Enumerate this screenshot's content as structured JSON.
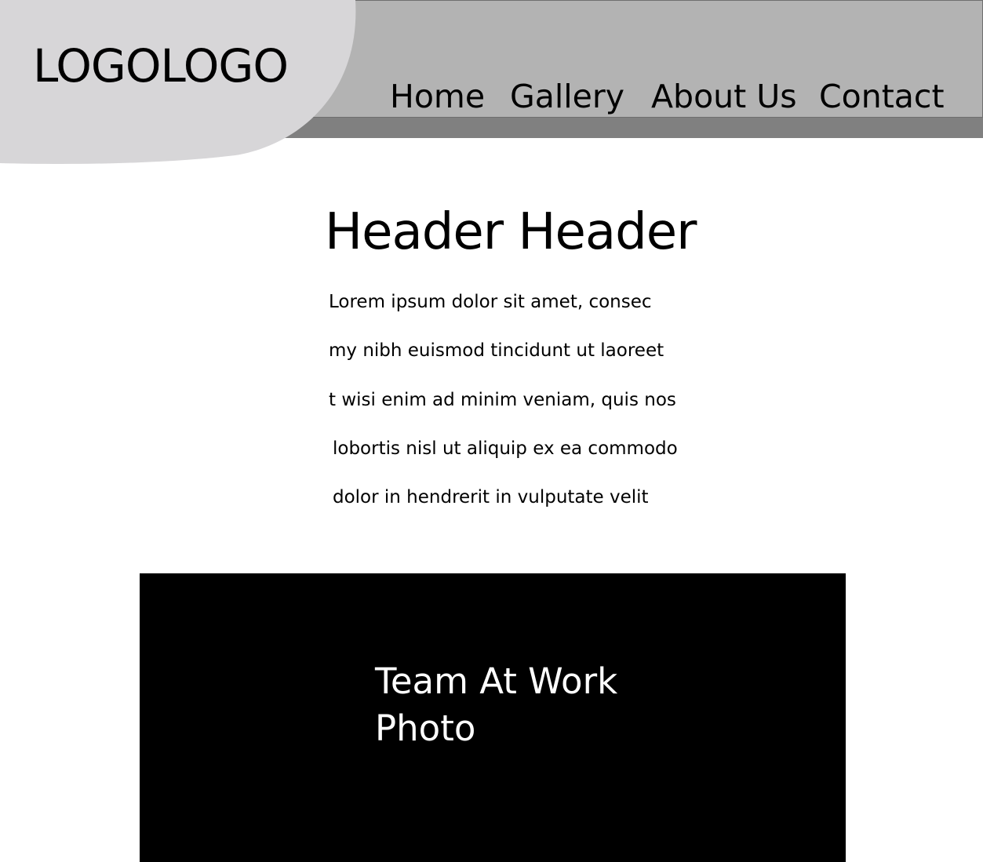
{
  "header": {
    "logo_text": "LOGOLOGO",
    "nav": [
      {
        "label": "Home"
      },
      {
        "label": "Gallery"
      },
      {
        "label": "About Us"
      },
      {
        "label": "Contact"
      }
    ]
  },
  "main": {
    "title": "Header Header",
    "paragraph_lines": [
      "Lorem ipsum dolor sit amet, consec",
      "my nibh euismod tincidunt ut laoreet",
      "t wisi enim ad minim veniam, quis nos",
      "lobortis nisl ut aliquip ex ea commodo",
      "dolor in hendrerit in vulputate velit"
    ]
  },
  "photo": {
    "caption_line1": "Team At Work",
    "caption_line2": "Photo"
  },
  "colors": {
    "nav_background": "#b3b3b3",
    "nav_shadow": "#808080",
    "logo_shape": "#d7d6d8",
    "photo_background": "#000000",
    "text": "#000000",
    "photo_text": "#ffffff"
  }
}
